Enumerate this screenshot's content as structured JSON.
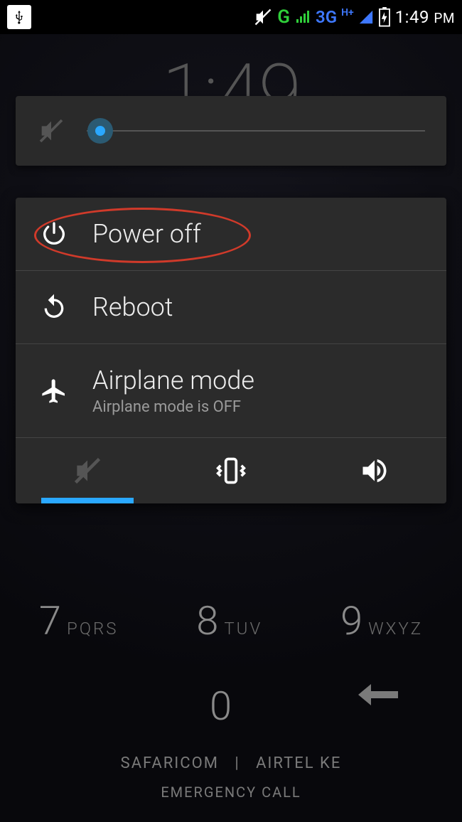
{
  "status": {
    "g_label": "G",
    "threeg_label": "3G",
    "hplus": "H+",
    "time": "1:49",
    "ampm": "PM"
  },
  "background": {
    "clock": "1:49",
    "key7_digit": "7",
    "key7_letters": "PQRS",
    "key8_digit": "8",
    "key8_letters": "TUV",
    "key9_digit": "9",
    "key9_letters": "WXYZ",
    "key0_digit": "0",
    "carrier1": "SAFARICOM",
    "carrier_sep": "|",
    "carrier2": "AIRTEL KE",
    "emergency": "EMERGENCY CALL"
  },
  "power_menu": {
    "power_off": "Power off",
    "reboot": "Reboot",
    "airplane_title": "Airplane mode",
    "airplane_sub": "Airplane mode is OFF"
  }
}
